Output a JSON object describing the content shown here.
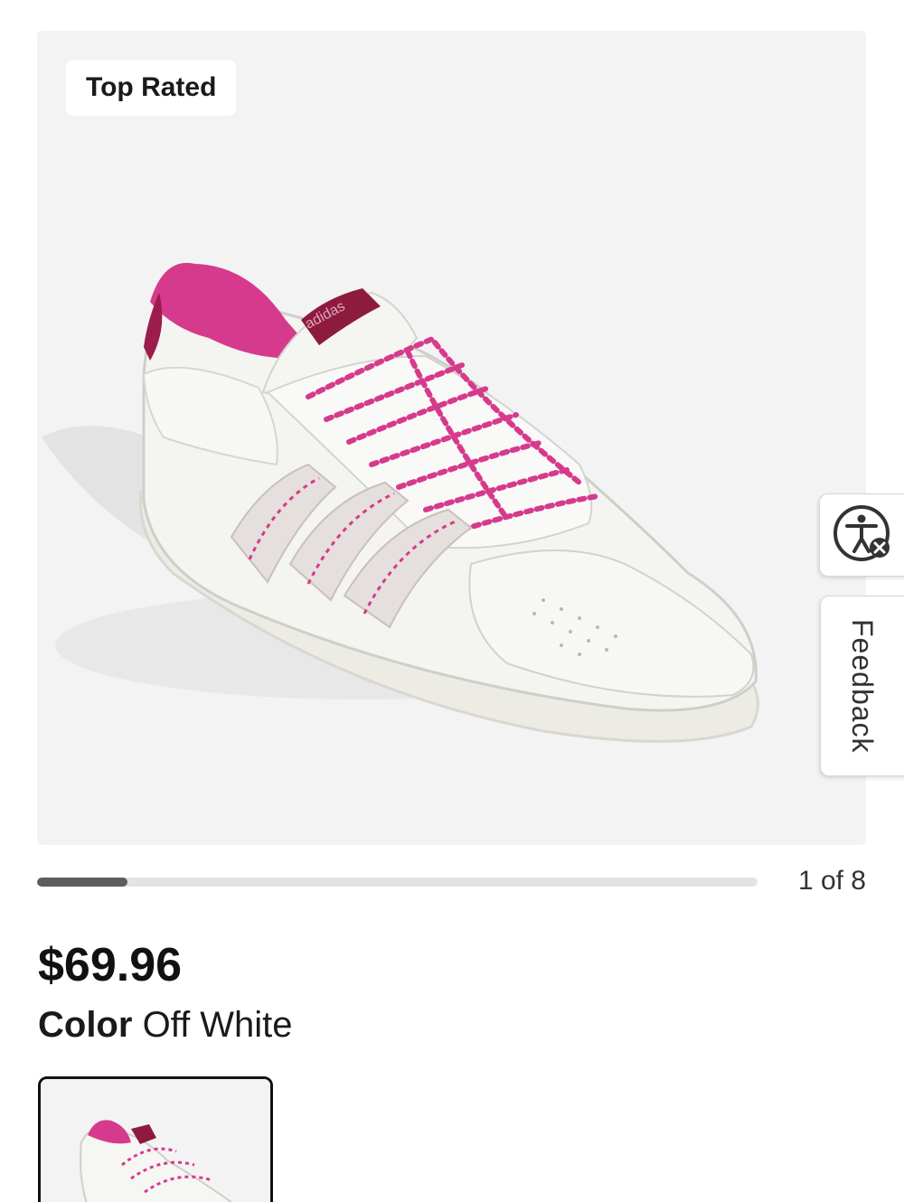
{
  "gallery": {
    "badge": "Top Rated",
    "image_alt": "adidas off white sneaker with pink heel and laces",
    "brand_tag": "adidas",
    "counter": "1 of 8",
    "progress_fraction": 0.125
  },
  "side_tabs": {
    "accessibility_icon": "accessibility-icon",
    "feedback_label": "Feedback"
  },
  "product": {
    "price": "$69.96",
    "color_label": "Color",
    "color_value": "Off White"
  },
  "colors": {
    "gallery_bg": "#f3f3f3",
    "accent_pink": "#d63a8d",
    "progress_fill": "#5d5d5d",
    "progress_track": "#e3e3e3"
  }
}
